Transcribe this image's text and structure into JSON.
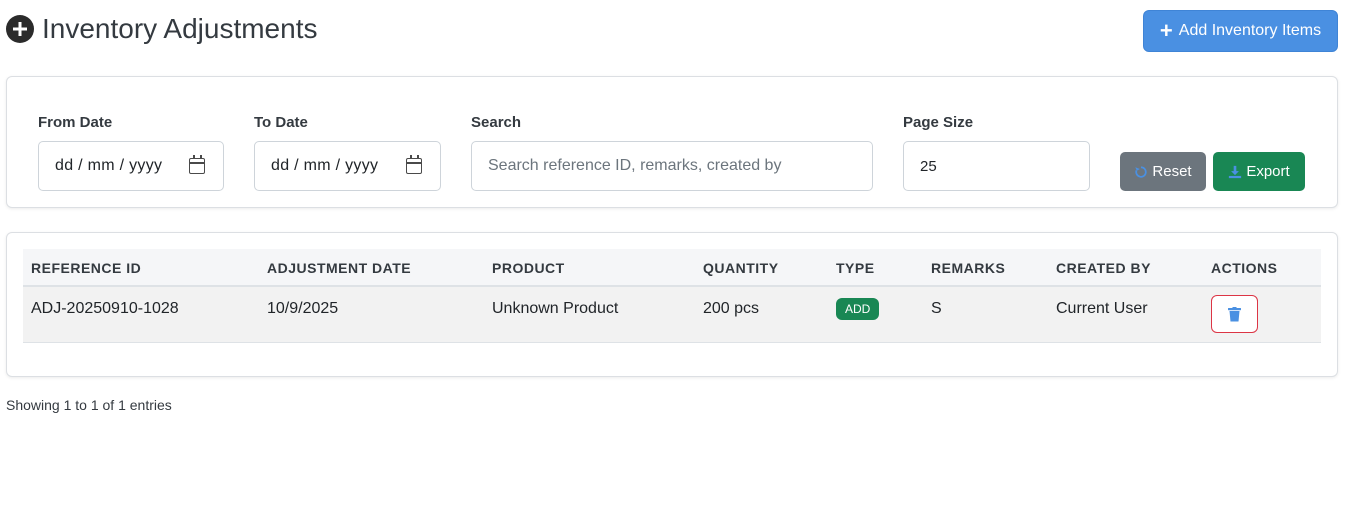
{
  "header": {
    "title": "Inventory Adjustments",
    "add_button_label": "Add Inventory Items"
  },
  "filters": {
    "from_date_label": "From Date",
    "from_date_value": "dd / mm / yyyy",
    "to_date_label": "To Date",
    "to_date_value": "dd / mm / yyyy",
    "search_label": "Search",
    "search_placeholder": "Search reference ID, remarks, created by",
    "page_size_label": "Page Size",
    "page_size_value": "25",
    "reset_label": "Reset",
    "export_label": "Export"
  },
  "table": {
    "columns": [
      "REFERENCE ID",
      "ADJUSTMENT DATE",
      "PRODUCT",
      "QUANTITY",
      "TYPE",
      "REMARKS",
      "CREATED BY",
      "ACTIONS"
    ],
    "rows": [
      {
        "reference_id": "ADJ-20250910-1028",
        "adjustment_date": "10/9/2025",
        "product": "Unknown Product",
        "quantity": "200 pcs",
        "type": "ADD",
        "remarks": "S",
        "created_by": "Current User"
      }
    ]
  },
  "footer": {
    "entries_text": "Showing 1 to 1 of 1 entries"
  },
  "colors": {
    "primary": "#4a90e2",
    "success": "#198754",
    "secondary": "#6c757d",
    "danger": "#dc3545"
  },
  "icons": {
    "title": "plus-circle-icon",
    "add": "plus-icon",
    "reset": "refresh-icon",
    "export": "download-icon",
    "delete": "trash-icon",
    "date": "calendar-icon"
  }
}
